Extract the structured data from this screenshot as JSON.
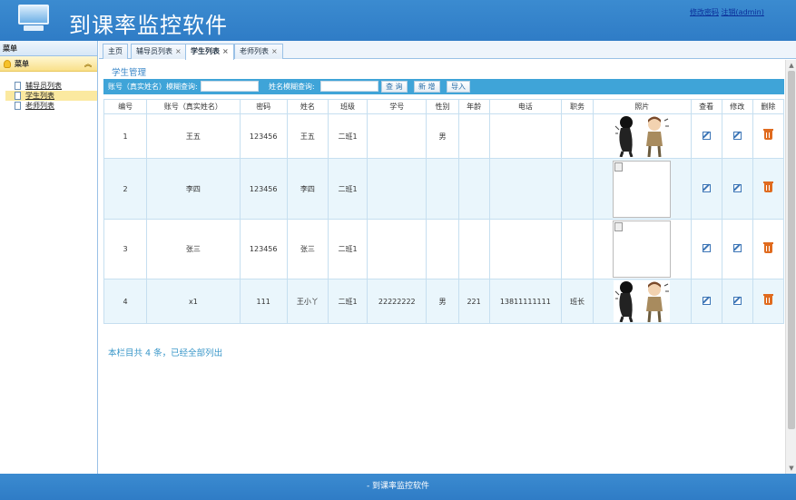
{
  "header": {
    "title": "到课率监控软件",
    "link_change_password": "修改密码",
    "link_logout": "注销(admin)"
  },
  "sidebar": {
    "title": "菜单",
    "group_label": "菜单",
    "items": [
      {
        "label": "辅导员列表",
        "active": false
      },
      {
        "label": "学生列表",
        "active": true
      },
      {
        "label": "老师列表",
        "active": false
      }
    ]
  },
  "tabs": [
    {
      "label": "主页",
      "closable": false,
      "active": false
    },
    {
      "label": "辅导员列表",
      "closable": true,
      "active": false
    },
    {
      "label": "学生列表",
      "closable": true,
      "active": true
    },
    {
      "label": "老师列表",
      "closable": true,
      "active": false
    }
  ],
  "page": {
    "section_title": "学生管理",
    "search": {
      "account_label": "账号（真实姓名）模糊查询:",
      "account_value": "",
      "name_label": "姓名模糊查询:",
      "name_value": "",
      "query_button": "查 询",
      "add_button": "新 增",
      "import_button": "导入"
    },
    "table": {
      "columns": [
        "编号",
        "账号（真实姓名）",
        "密码",
        "姓名",
        "班级",
        "学号",
        "性别",
        "年龄",
        "电话",
        "职务",
        "照片",
        "查看",
        "修改",
        "删除"
      ],
      "rows": [
        {
          "id": "1",
          "account": "王五",
          "password": "123456",
          "name": "王五",
          "class": "二班1",
          "student_no": "",
          "gender": "男",
          "age": "",
          "phone": "",
          "position": "",
          "photo": "cartoon"
        },
        {
          "id": "2",
          "account": "李四",
          "password": "123456",
          "name": "李四",
          "class": "二班1",
          "student_no": "",
          "gender": "",
          "age": "",
          "phone": "",
          "position": "",
          "photo": "broken"
        },
        {
          "id": "3",
          "account": "张三",
          "password": "123456",
          "name": "张三",
          "class": "二班1",
          "student_no": "",
          "gender": "",
          "age": "",
          "phone": "",
          "position": "",
          "photo": "broken"
        },
        {
          "id": "4",
          "account": "x1",
          "password": "111",
          "name": "王小丫",
          "class": "二班1",
          "student_no": "22222222",
          "gender": "男",
          "age": "221",
          "phone": "13811111111",
          "position": "班长",
          "photo": "cartoon"
        }
      ]
    },
    "footer_text": "本栏目共 4 条，已经全部列出"
  },
  "footer": {
    "text": "- 到课率监控软件"
  },
  "colors": {
    "header_blue": "#2f7cc6",
    "search_bar": "#3fa4d8",
    "row_alt": "#eaf6fc",
    "accent_text": "#3a87c8",
    "delete_icon": "#e06b1f"
  }
}
